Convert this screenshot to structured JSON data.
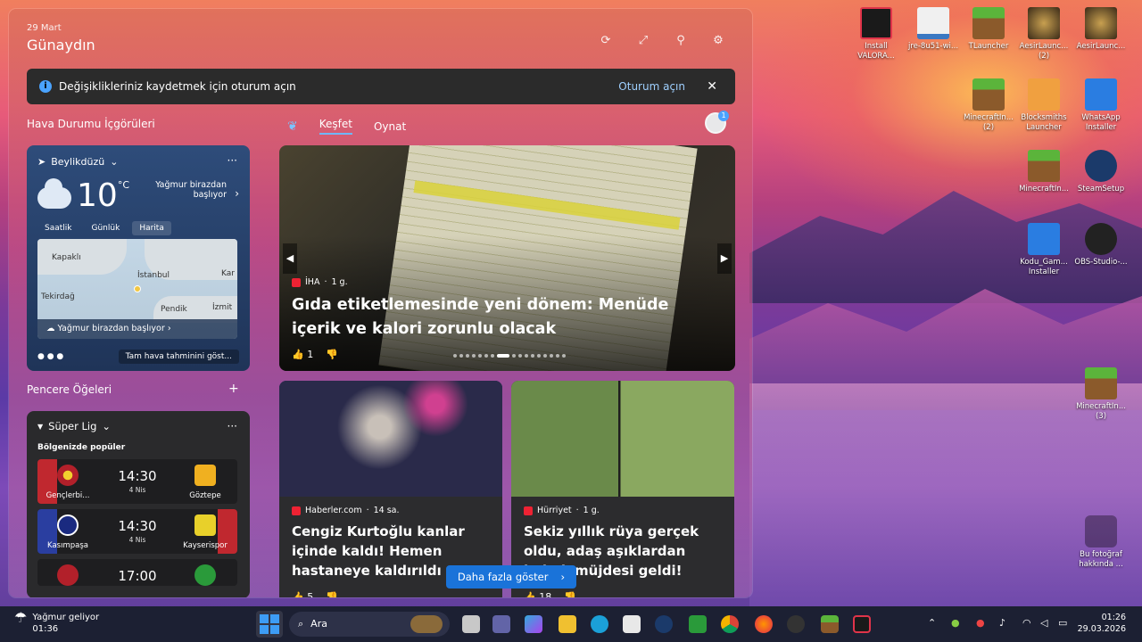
{
  "widgets": {
    "date": "29 Mart",
    "greeting": "Günaydın",
    "banner": {
      "text": "Değişiklikleriniz kaydetmek için oturum açın",
      "action": "Oturum açın"
    },
    "weather_section_title": "Hava Durumu İçgörüleri",
    "tabs": [
      "Keşfet",
      "Oynat"
    ],
    "weather": {
      "location": "Beylikdüzü",
      "temp": "10",
      "unit": "°C",
      "desc": "Yağmur birazdan başlıyor",
      "tabs": [
        "Saatlik",
        "Günlük",
        "Harita"
      ],
      "map_labels": {
        "kapakli": "Kapaklı",
        "istanbul": "İstanbul",
        "tekirdag": "Tekirdağ",
        "pendik": "Pendik",
        "izmit": "İzmit",
        "kar": "Kar"
      },
      "map_rain": "Yağmur birazdan başlıyor",
      "forecast_button": "Tam hava tahminini göst..."
    },
    "widgets_title": "Pencere Öğeleri",
    "sport": {
      "league": "Süper Lig",
      "sub": "Bölgenizde popüler",
      "matches": [
        {
          "home": "Gençlerbi...",
          "away": "Göztepe",
          "time": "14:30",
          "date": "4 Nis"
        },
        {
          "home": "Kasımpaşa",
          "away": "Kayserispor",
          "time": "14:30",
          "date": "4 Nis"
        },
        {
          "home": "",
          "away": "",
          "time": "17:00",
          "date": ""
        }
      ]
    },
    "hero": {
      "source": "İHA",
      "age": "1 g.",
      "title": "Gıda etiketlemesinde yeni dönem: Menüde içerik ve kalori zorunlu olacak",
      "likes": "1"
    },
    "card1": {
      "source": "Haberler.com",
      "age": "14 sa.",
      "title": "Cengiz Kurtoğlu kanlar içinde kaldı! Hemen hastaneye kaldırıldı",
      "likes": "5"
    },
    "card2": {
      "source": "Hürriyet",
      "age": "1 g.",
      "title": "Sekiz yıllık rüya gerçek oldu, adaş aşıklardan bebek müjdesi geldi!",
      "likes": "18"
    },
    "more_button": "Daha fazla göster"
  },
  "desktop": [
    {
      "label": "Install VALORA..."
    },
    {
      "label": "jre-8u51-wi..."
    },
    {
      "label": "TLauncher"
    },
    {
      "label": "AesirLaunc... (2)"
    },
    {
      "label": "AesirLaunc..."
    },
    {
      "label": "MinecraftIn... (2)"
    },
    {
      "label": "Blocksmiths Launcher"
    },
    {
      "label": "WhatsApp Installer"
    },
    {
      "label": "MinecraftIn..."
    },
    {
      "label": "SteamSetup"
    },
    {
      "label": "Kodu_Gam... Installer"
    },
    {
      "label": "OBS-Studio-..."
    },
    {
      "label": "MinecraftIn... (3)"
    },
    {
      "label": "Bu fotoğraf hakkında ..."
    }
  ],
  "taskbar": {
    "weather": "Yağmur geliyor",
    "weather_time": "01:36",
    "search": "Ara",
    "time": "01:26",
    "date": "29.03.2026"
  },
  "colors": {
    "accent": "#1a73d9",
    "taskbar": "#1c2033"
  }
}
